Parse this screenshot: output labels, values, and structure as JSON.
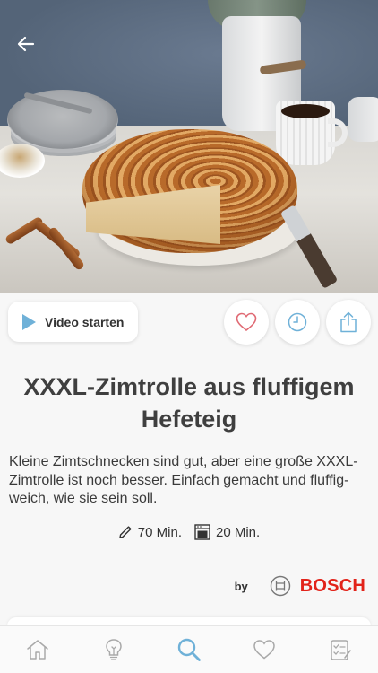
{
  "header": {
    "back_icon": "arrow-left-icon"
  },
  "actions": {
    "video_label": "Video starten",
    "favorite_icon": "heart-icon",
    "timer_icon": "clock-icon",
    "share_icon": "share-icon"
  },
  "recipe": {
    "title": "XXXL-Zimtrolle aus fluffigem Hefeteig",
    "description": "Kleine Zimtschnecken sind gut, aber eine große XXXL-Zimtrolle ist noch besser. Einfach gemacht und fluffig-weich, wie sie sein soll.",
    "prep_time": "70 Min.",
    "bake_time": "20 Min."
  },
  "brand": {
    "by_label": "by",
    "name": "BOSCH"
  },
  "colors": {
    "accent": "#6fb1d8",
    "heart": "#e06a74",
    "brand_red": "#e2231a"
  },
  "tabbar": {
    "items": [
      {
        "name": "home",
        "icon": "home-icon"
      },
      {
        "name": "inspiration",
        "icon": "lightbulb-icon"
      },
      {
        "name": "search",
        "icon": "search-icon",
        "active": true
      },
      {
        "name": "favorites",
        "icon": "heart-icon"
      },
      {
        "name": "shopping-list",
        "icon": "checklist-icon"
      }
    ]
  }
}
